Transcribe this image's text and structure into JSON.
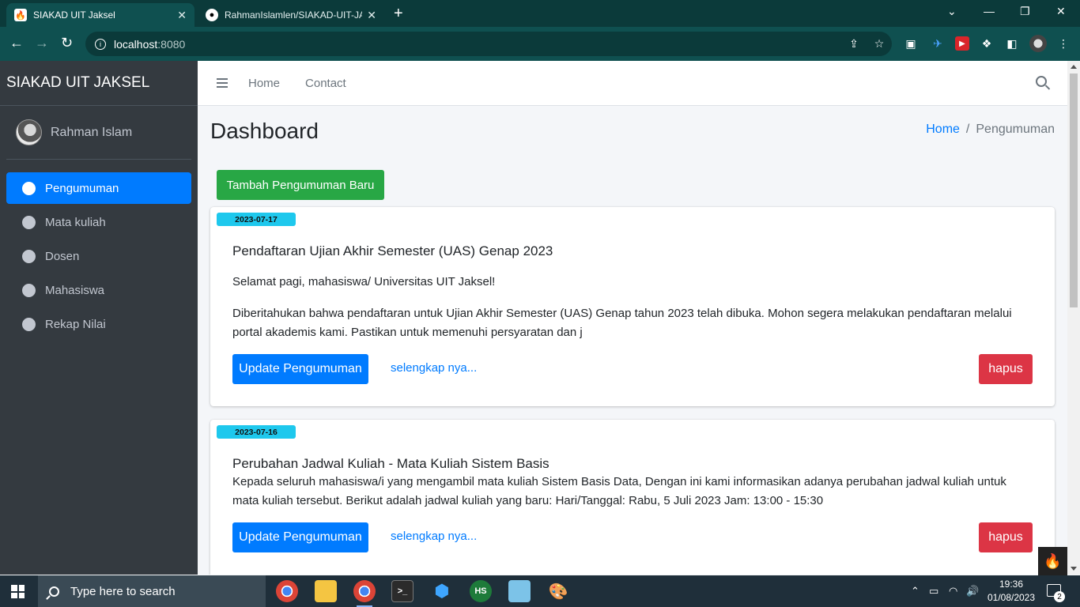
{
  "browser": {
    "tabs": [
      {
        "title": "SIAKAD UIT Jaksel",
        "active": true
      },
      {
        "title": "RahmanIslamlen/SIAKAD-UIT-JAKSEL",
        "active": false
      }
    ],
    "url_host": "localhost",
    "url_port": ":8080"
  },
  "sidebar": {
    "brand": "SIAKAD UIT JAKSEL",
    "user_name": "Rahman Islam",
    "items": [
      {
        "label": "Pengumuman",
        "active": true
      },
      {
        "label": "Mata kuliah",
        "active": false
      },
      {
        "label": "Dosen",
        "active": false
      },
      {
        "label": "Mahasiswa",
        "active": false
      },
      {
        "label": "Rekap Nilai",
        "active": false
      }
    ]
  },
  "topnav": {
    "links": [
      "Home",
      "Contact"
    ]
  },
  "page": {
    "title": "Dashboard",
    "breadcrumb": {
      "home": "Home",
      "current": "Pengumuman",
      "separator": "/"
    },
    "add_button": "Tambah Pengumuman Baru"
  },
  "announcements": [
    {
      "date": "2023-07-17",
      "title": "Pendaftaran Ujian Akhir Semester (UAS) Genap 2023",
      "greeting": "Selamat pagi, mahasiswa/ Universitas UIT Jaksel!",
      "body": "Diberitahukan bahwa pendaftaran untuk Ujian Akhir Semester (UAS) Genap tahun 2023 telah dibuka. Mohon segera melakukan pendaftaran melalui portal akademis kami. Pastikan untuk memenuhi persyaratan dan j",
      "update_label": "Update Pengumuman",
      "more_label": "selengkap nya...",
      "delete_label": "hapus"
    },
    {
      "date": "2023-07-16",
      "title": "Perubahan Jadwal Kuliah - Mata Kuliah Sistem Basis",
      "greeting": "",
      "body": "Kepada seluruh mahasiswa/i yang mengambil mata kuliah Sistem Basis Data, Dengan ini kami informasikan adanya perubahan jadwal kuliah untuk mata kuliah tersebut. Berikut adalah jadwal kuliah yang baru: Hari/Tanggal: Rabu, 5 Juli 2023 Jam: 13:00 - 15:30",
      "update_label": "Update Pengumuman",
      "more_label": "selengkap nya...",
      "delete_label": "hapus"
    }
  ],
  "taskbar": {
    "search_placeholder": "Type here to search",
    "time": "19:36",
    "date": "01/08/2023",
    "notification_count": "2",
    "app_hs_label": "HS"
  },
  "colors": {
    "primary": "#007bff",
    "success": "#28a745",
    "danger": "#dc3545",
    "info": "#1ec8ed",
    "sidebar_bg": "#343a40"
  }
}
